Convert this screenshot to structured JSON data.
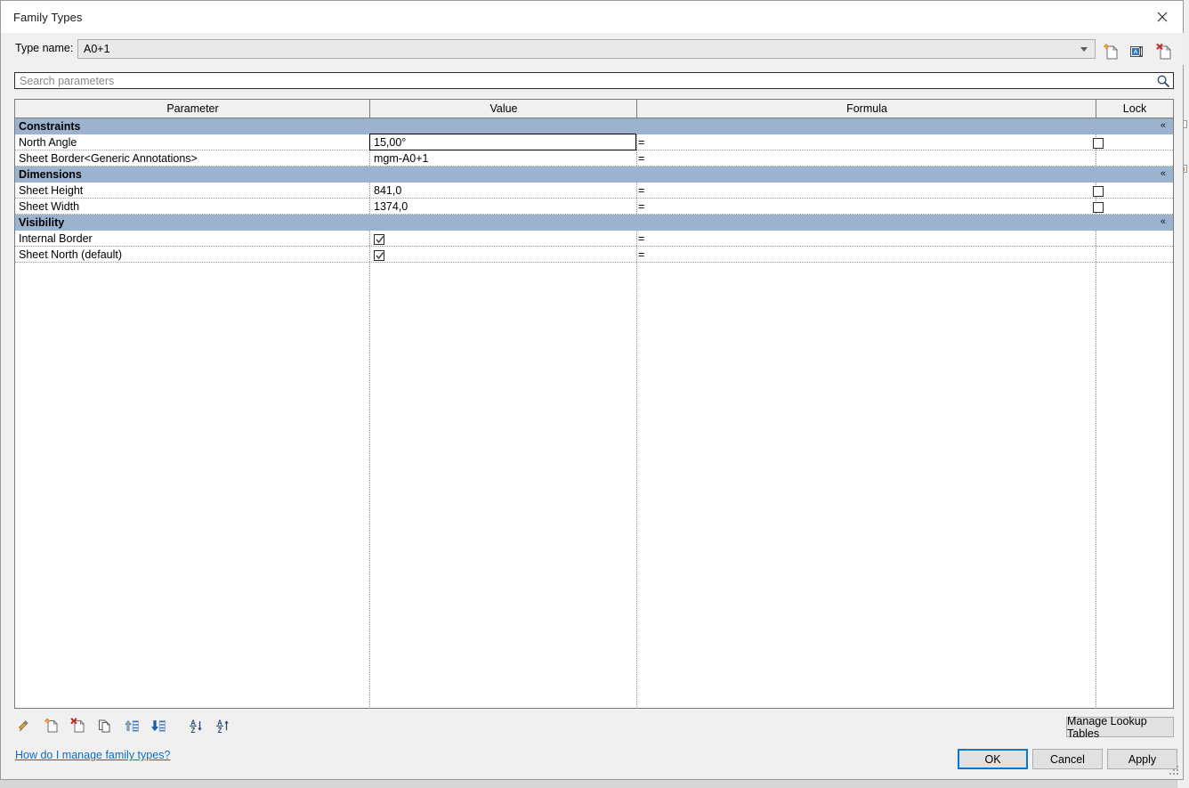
{
  "window": {
    "title": "Family Types",
    "close_icon": "close-icon"
  },
  "type_row": {
    "label": "Type name:",
    "value": "A0+1",
    "dropdown_icon": "chevron-down-icon",
    "actions": [
      {
        "name": "new-type-icon",
        "tooltip": "New Type"
      },
      {
        "name": "rename-type-icon",
        "tooltip": "Rename"
      },
      {
        "name": "delete-type-icon",
        "tooltip": "Delete Type"
      }
    ]
  },
  "search": {
    "placeholder": "Search parameters",
    "value": "",
    "icon": "search-icon"
  },
  "table": {
    "columns": [
      {
        "key": "parameter",
        "label": "Parameter"
      },
      {
        "key": "value",
        "label": "Value"
      },
      {
        "key": "formula",
        "label": "Formula"
      },
      {
        "key": "lock",
        "label": "Lock"
      }
    ],
    "collapse_icon": "chevron-up-icon",
    "groups": [
      {
        "name": "Constraints",
        "rows": [
          {
            "parameter": "North Angle",
            "value": "15,00°",
            "type": "text",
            "editing": true,
            "formula": "=",
            "lock": "unchecked"
          },
          {
            "parameter": "Sheet Border<Generic Annotations>",
            "value": "mgm-A0+1",
            "type": "text",
            "editing": false,
            "formula": "=",
            "lock": "none"
          }
        ]
      },
      {
        "name": "Dimensions",
        "rows": [
          {
            "parameter": "Sheet Height",
            "value": "841,0",
            "type": "text",
            "editing": false,
            "formula": "=",
            "lock": "unchecked"
          },
          {
            "parameter": "Sheet Width",
            "value": "1374,0",
            "type": "text",
            "editing": false,
            "formula": "=",
            "lock": "unchecked"
          }
        ]
      },
      {
        "name": "Visibility",
        "rows": [
          {
            "parameter": "Internal Border",
            "value": "checked",
            "type": "checkbox",
            "editing": false,
            "formula": "=",
            "lock": "none"
          },
          {
            "parameter": "Sheet North (default)",
            "value": "checked",
            "type": "checkbox",
            "editing": false,
            "formula": "=",
            "lock": "none"
          }
        ]
      }
    ]
  },
  "bottom_toolbar": {
    "tools": [
      {
        "name": "edit-parameter-icon",
        "tooltip": "Edit Parameter"
      },
      {
        "name": "new-parameter-icon",
        "tooltip": "New Parameter"
      },
      {
        "name": "delete-parameter-icon",
        "tooltip": "Remove Parameter"
      },
      {
        "name": "duplicate-parameter-icon",
        "tooltip": "Duplicate"
      },
      {
        "name": "move-up-icon",
        "tooltip": "Move Up"
      },
      {
        "name": "move-down-icon",
        "tooltip": "Move Down"
      },
      {
        "name": "sort-descending-icon",
        "tooltip": "Sort Descending"
      },
      {
        "name": "sort-ascending-icon",
        "tooltip": "Sort Ascending"
      }
    ]
  },
  "footer": {
    "help_link": "How do I manage family types?",
    "manage_lookup_tables": "Manage Lookup Tables",
    "ok": "OK",
    "cancel": "Cancel",
    "apply": "Apply"
  },
  "colors": {
    "group_header": "#9cb3cf",
    "accent": "#0078d7",
    "link": "#0b6ec7",
    "dialog_bg": "#f0f0f0"
  }
}
